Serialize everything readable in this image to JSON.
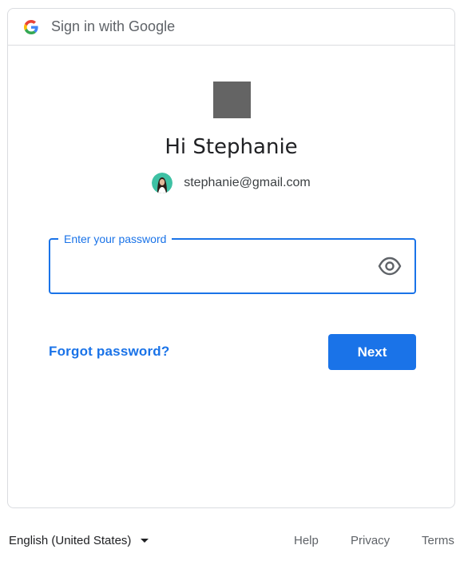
{
  "header": {
    "title": "Sign in with Google",
    "logo_icon": "google-g-icon"
  },
  "greeting": "Hi Stephanie",
  "account": {
    "email": "stephanie@gmail.com",
    "avatar_icon": "user-avatar"
  },
  "password_field": {
    "label": "Enter your password",
    "value": "",
    "toggle_icon": "eye-icon"
  },
  "actions": {
    "forgot_label": "Forgot password?",
    "next_label": "Next"
  },
  "footer": {
    "language": "English (United States)",
    "help": "Help",
    "privacy": "Privacy",
    "terms": "Terms"
  },
  "colors": {
    "accent": "#1a73e8",
    "border": "#dadce0",
    "brand_placeholder": "#646464"
  }
}
